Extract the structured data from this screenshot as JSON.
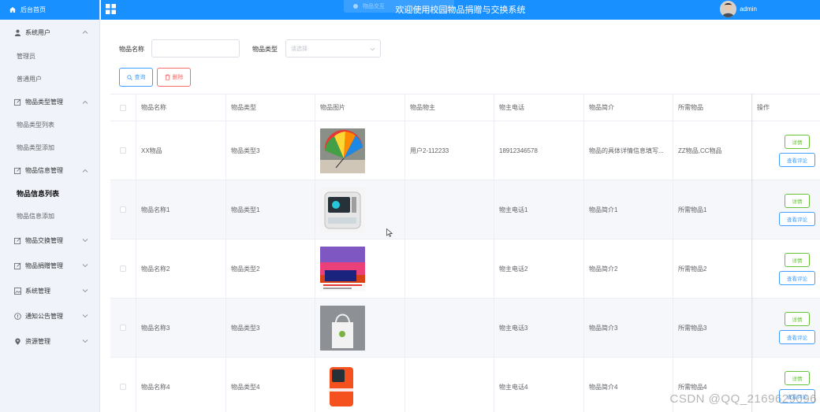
{
  "brand": "后台首页",
  "header": {
    "title": "欢迎使用校园物品捐赠与交换系统",
    "tab_ghost": "物品交互",
    "username": "admin"
  },
  "sidebar": {
    "sys_user": {
      "label": "系统用户",
      "subs": [
        "管理员",
        "普通用户"
      ]
    },
    "cat_mgmt": {
      "label": "物品类型管理",
      "subs": [
        "物品类型列表",
        "物品类型添加"
      ]
    },
    "info_mgmt": {
      "label": "物品信息管理",
      "subs": [
        "物品信息列表",
        "物品信息添加"
      ]
    },
    "exchange_mgmt": {
      "label": "物品交换管理"
    },
    "donation_mgmt": {
      "label": "物品捐赠管理"
    },
    "system_mgmt": {
      "label": "系统管理"
    },
    "notice_mgmt": {
      "label": "通知公告管理"
    },
    "resource_mgmt": {
      "label": "资源管理"
    }
  },
  "filters": {
    "name_label": "物品名称",
    "name_value": "",
    "type_label": "物品类型",
    "type_placeholder": "请选择",
    "search_btn": "查询",
    "delete_btn": "删除"
  },
  "table": {
    "columns": [
      "物品名称",
      "物品类型",
      "物品图片",
      "物品物主",
      "物主电话",
      "物品简介",
      "所需物品",
      "操作"
    ],
    "detail_btn": "详情",
    "review_btn": "查看评论",
    "rows": [
      {
        "name": "XX物品",
        "type": "物品类型3",
        "image": "rainbow-umbrella",
        "owner": "用户2-112233",
        "phone": "18912346578",
        "intro": "物品的具体详情信息填写...",
        "need": "ZZ物品,CC物品"
      },
      {
        "name": "物品名称1",
        "type": "物品类型1",
        "image": "desktop-pc",
        "owner": "",
        "phone": "物主电话1",
        "intro": "物品简介1",
        "need": "所需物品1"
      },
      {
        "name": "物品名称2",
        "type": "物品类型2",
        "image": "colorful-monitor",
        "owner": "",
        "phone": "物主电话2",
        "intro": "物品简介2",
        "need": "所需物品2"
      },
      {
        "name": "物品名称3",
        "type": "物品类型3",
        "image": "tote-bag",
        "owner": "",
        "phone": "物主电话3",
        "intro": "物品简介3",
        "need": "所需物品3"
      },
      {
        "name": "物品名称4",
        "type": "物品类型4",
        "image": "orange-phone",
        "owner": "",
        "phone": "物主电话4",
        "intro": "物品简介4",
        "need": "所需物品4"
      }
    ]
  },
  "watermark": "CSDN @QQ_2169629096",
  "colors": {
    "primary": "#1890ff",
    "sidebar_bg": "#f0f4fa",
    "success": "#67c23a",
    "danger": "#f56c6c",
    "link": "#409eff"
  }
}
